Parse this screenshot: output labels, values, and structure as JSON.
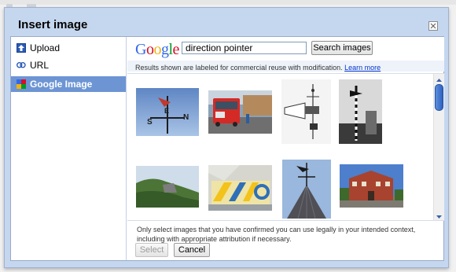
{
  "dialog": {
    "title": "Insert image"
  },
  "sidebar": {
    "items": [
      {
        "label": "Upload",
        "icon": "upload-icon"
      },
      {
        "label": "URL",
        "icon": "link-icon"
      },
      {
        "label": "Google Image Search",
        "icon": "google-icon",
        "selected": true
      }
    ]
  },
  "search": {
    "logo_text": "Google",
    "query": "direction pointer",
    "button_label": "Search images",
    "notice": "Results shown are labeled for commercial reuse with modification.",
    "learn_more": "Learn more"
  },
  "results": {
    "thumbnails": [
      {
        "alt": "Weather vane with directional letters against blue sky"
      },
      {
        "alt": "Red bus on a street"
      },
      {
        "alt": "Black and white wind vane drawing"
      },
      {
        "alt": "Striped pole weather instrument"
      },
      {
        "alt": "Grassy hillside with rock"
      },
      {
        "alt": "Yellow and blue painted wall"
      },
      {
        "alt": "Weather vane on pointed roof"
      },
      {
        "alt": "Brick building with blue sky"
      }
    ]
  },
  "footer": {
    "text": "Only select images that you have confirmed you can use legally in your intended context, including with appropriate attribution if necessary.",
    "select_label": "Select",
    "cancel_label": "Cancel"
  },
  "colors": {
    "accent": "#6d95d4",
    "dialog_bg": "#c5d7ef",
    "link": "#0033cc"
  }
}
